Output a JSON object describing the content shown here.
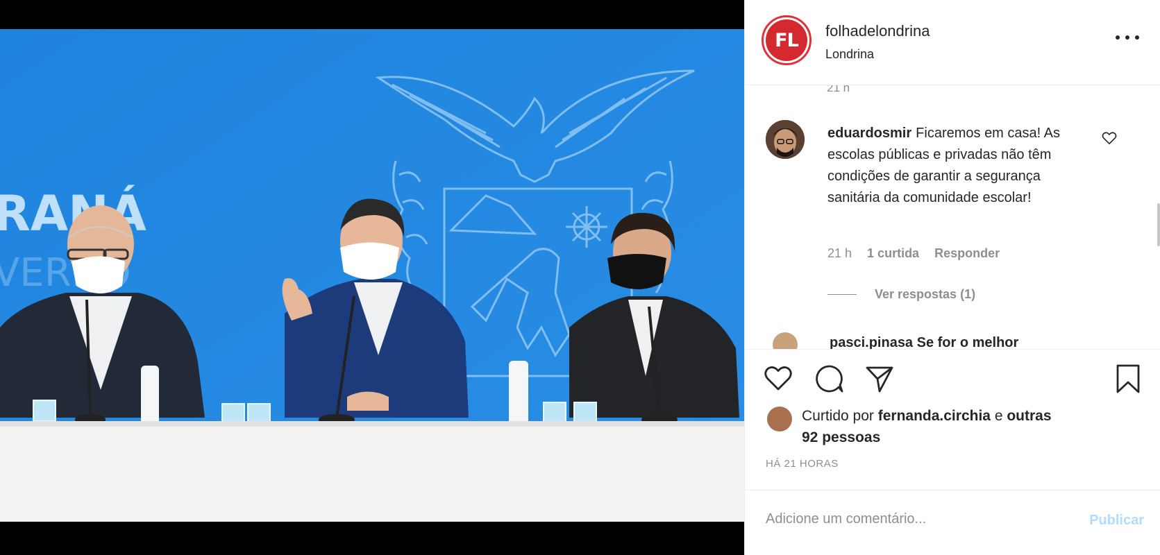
{
  "post": {
    "username": "folhadelondrina",
    "location": "Londrina",
    "avatar_text": "FL",
    "brand_color": "#d42a2f"
  },
  "photo": {
    "banner_text_1": "RANÁ",
    "banner_text_2": "VERNO"
  },
  "comment": {
    "cut_top_text": "21 h",
    "user": "eduardosmir",
    "text": "Ficaremos em casa! As escolas públicas e privadas não têm condições de garantir a segurança sanitária da comunidade escolar!",
    "time": "21 h",
    "likes": "1 curtida",
    "reply": "Responder",
    "view_replies": "Ver respostas (1)",
    "next_cut": "pasci.pinasa Se for o melhor"
  },
  "actions": {
    "icons": [
      "heart-icon",
      "comment-icon",
      "share-icon",
      "bookmark-icon"
    ]
  },
  "likes": {
    "prefix": "Curtido por",
    "user": "fernanda.circhia",
    "mid": "e",
    "others": "outras 92 pessoas"
  },
  "timestamp": "HÁ 21 HORAS",
  "add_comment": {
    "placeholder": "Adicione um comentário...",
    "publish": "Publicar"
  }
}
